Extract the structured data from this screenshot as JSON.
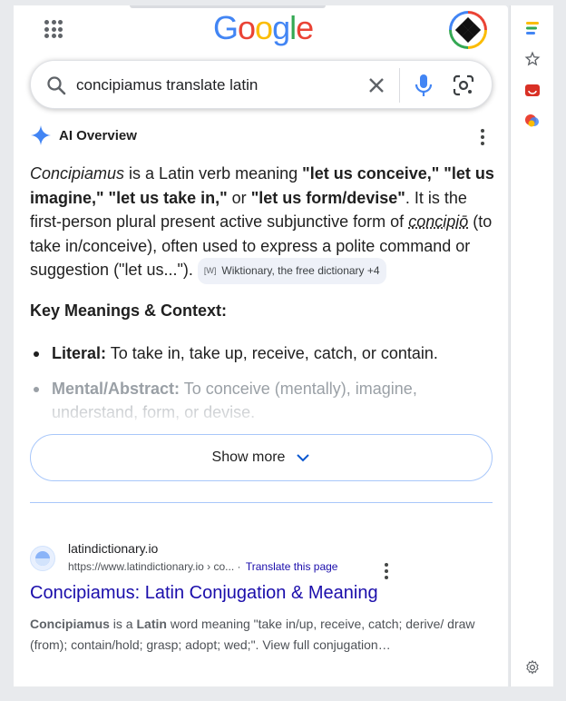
{
  "logo": {
    "letters": [
      {
        "ch": "G",
        "color": "#4285f4"
      },
      {
        "ch": "o",
        "color": "#ea4335"
      },
      {
        "ch": "o",
        "color": "#fbbc04"
      },
      {
        "ch": "g",
        "color": "#4285f4"
      },
      {
        "ch": "l",
        "color": "#34a853"
      },
      {
        "ch": "e",
        "color": "#ea4335"
      }
    ]
  },
  "search": {
    "query": "concipiamus translate latin"
  },
  "ai_overview": {
    "title": "AI Overview",
    "para": {
      "w1": "Concipiamus",
      "t1": " is a Latin verb meaning ",
      "b1": "\"let us conceive,\" \"let us imagine,\" \"let us take in,\"",
      "t2": " or ",
      "b2": "\"let us form/devise\"",
      "t3": ". It is the first-person plural present active subjunctive form of ",
      "link": "concipiō",
      "t4": " (to take in/conceive), often used to express a polite command or suggestion (\"let us...\"). "
    },
    "source_chip": "Wiktionary, the free dictionary +4",
    "key_heading": "Key Meanings & Context:",
    "bullets": [
      {
        "label": "Literal:",
        "text": " To take in, take up, receive, catch, or contain."
      },
      {
        "label": "Mental/Abstract:",
        "text": " To conceive (mentally), imagine, understand, form, or devise."
      }
    ],
    "show_more": "Show more"
  },
  "result": {
    "site_name": "latindictionary.io",
    "url": "https://www.latindictionary.io › co...",
    "translate": "Translate this page",
    "title": "Concipiamus: Latin Conjugation & Meaning",
    "snippet_b1": "Concipiamus",
    "snippet_t1": " is a ",
    "snippet_b2": "Latin",
    "snippet_t2": " word meaning \"take in/up, receive, catch; derive/ draw (from); contain/hold; grasp; adopt; wed;\". View full conjugation…"
  },
  "colors": {
    "link": "#1a0dab",
    "accent": "#a8c7fa",
    "ai_star": "#4285f4"
  }
}
